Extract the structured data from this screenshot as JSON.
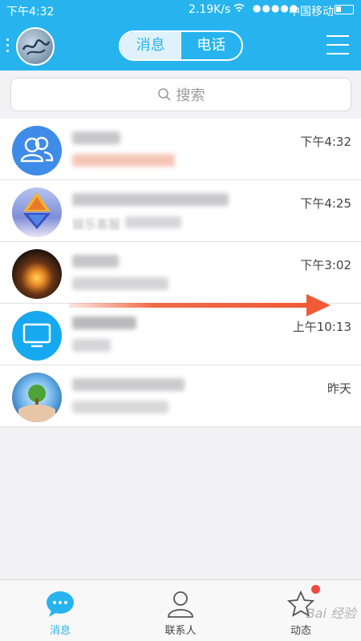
{
  "status_bar": {
    "time": "下午4:32",
    "speed": "2.19K/s",
    "signal": "●●●●●",
    "carrier": "中国移动"
  },
  "header": {
    "tabs": [
      {
        "label": "消息",
        "active": true
      },
      {
        "label": "电话",
        "active": false
      }
    ]
  },
  "search": {
    "placeholder": "搜索"
  },
  "conversations": [
    {
      "name": "",
      "preview": "",
      "time": "下午4:32",
      "avatar": "group-icon",
      "avatar_color": "#3f8be8"
    },
    {
      "name": "",
      "preview": "娱乐客服",
      "time": "下午4:25",
      "avatar": "triangle-logo",
      "avatar_color": "#6a7fd1"
    },
    {
      "name": "",
      "preview": "",
      "time": "下午3:02",
      "avatar": "sunset-photo",
      "avatar_color": "#3a2a1e"
    },
    {
      "name": "",
      "preview": "",
      "time": "上午10:13",
      "avatar": "monitor-icon",
      "avatar_color": "#17a9ef"
    },
    {
      "name": "",
      "preview": "",
      "time": "昨天",
      "avatar": "tree-globe-photo",
      "avatar_color": "#3b86c6"
    }
  ],
  "bottom_nav": {
    "tabs": [
      {
        "label": "消息",
        "icon": "chat-bubble-icon",
        "active": true
      },
      {
        "label": "联系人",
        "icon": "person-icon",
        "active": false
      },
      {
        "label": "动态",
        "icon": "star-icon",
        "active": false,
        "badge": true
      }
    ]
  },
  "watermark": "Bai 经验",
  "colors": {
    "accent": "#27b4ee",
    "arrow": "#f05a35",
    "badge": "#f04a3c"
  }
}
